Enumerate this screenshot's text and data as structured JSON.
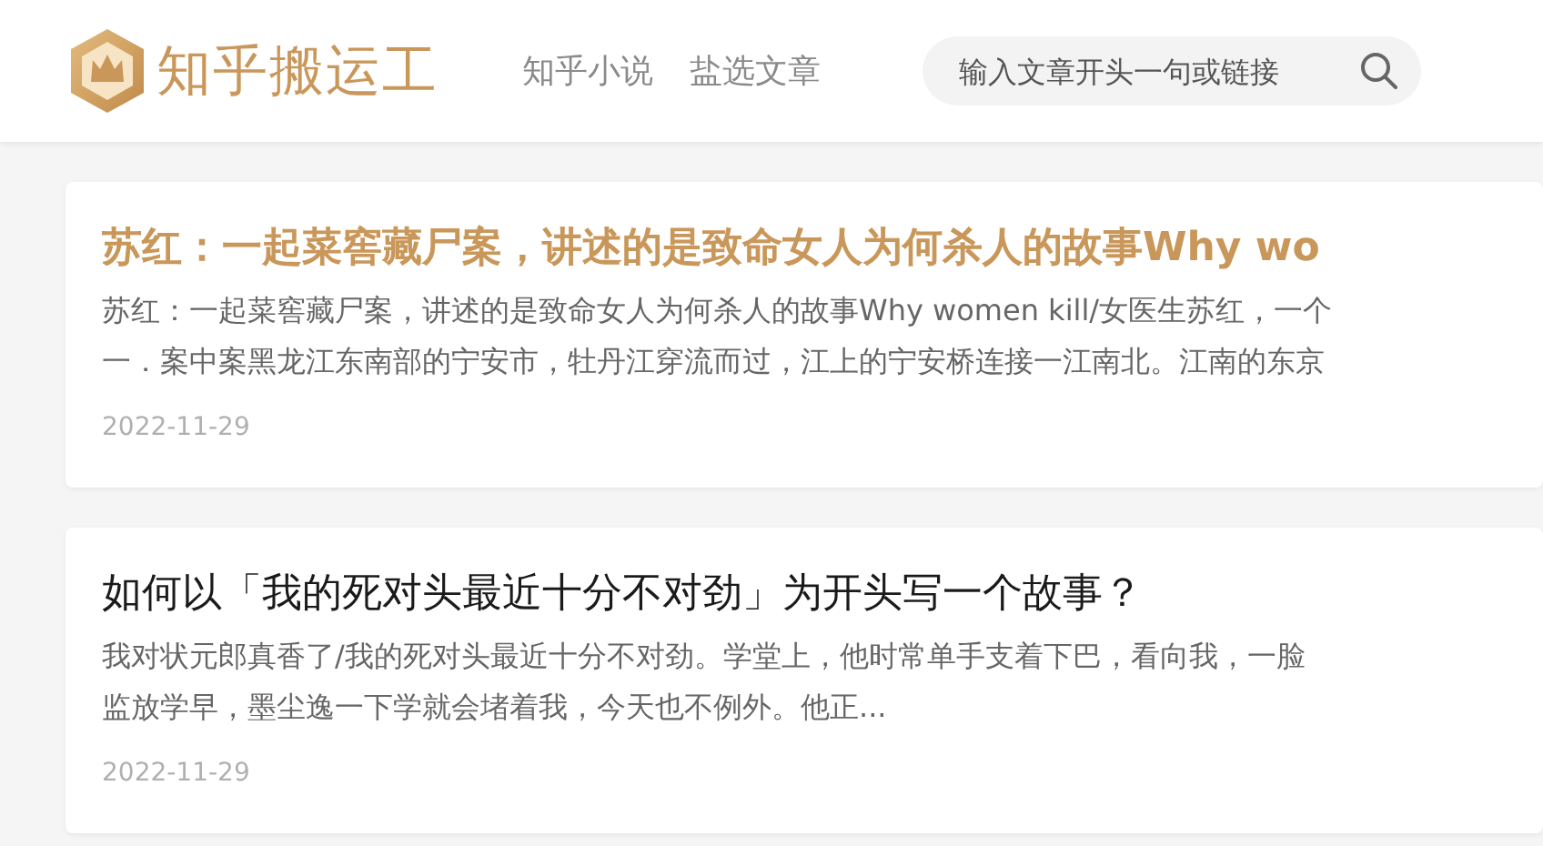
{
  "header": {
    "logo_text": "知乎搬运工",
    "nav": [
      {
        "label": "知乎小说"
      },
      {
        "label": "盐选文章"
      }
    ],
    "search": {
      "placeholder": "输入文章开头一句或链接"
    }
  },
  "articles": [
    {
      "title": "苏红：一起菜窖藏尸案，讲述的是致命女人为何杀人的故事Why wo",
      "highlighted": true,
      "lines": [
        "苏红：一起菜窖藏尸案，讲述的是致命女人为何杀人的故事Why women kill/女医生苏红，一个",
        "一．案中案黑龙江东南部的宁安市，牡丹江穿流而过，江上的宁安桥连接一江南北。江南的东京"
      ],
      "date": "2022-11-29"
    },
    {
      "title": "如何以「我的死对头最近十分不对劲」为开头写一个故事？",
      "highlighted": false,
      "lines": [
        "我对状元郎真香了/我的死对头最近十分不对劲。学堂上，他时常单手支着下巴，看向我，一脸",
        "监放学早，墨尘逸一下学就会堵着我，今天也不例外。他正..."
      ],
      "date": "2022-11-29"
    }
  ]
}
